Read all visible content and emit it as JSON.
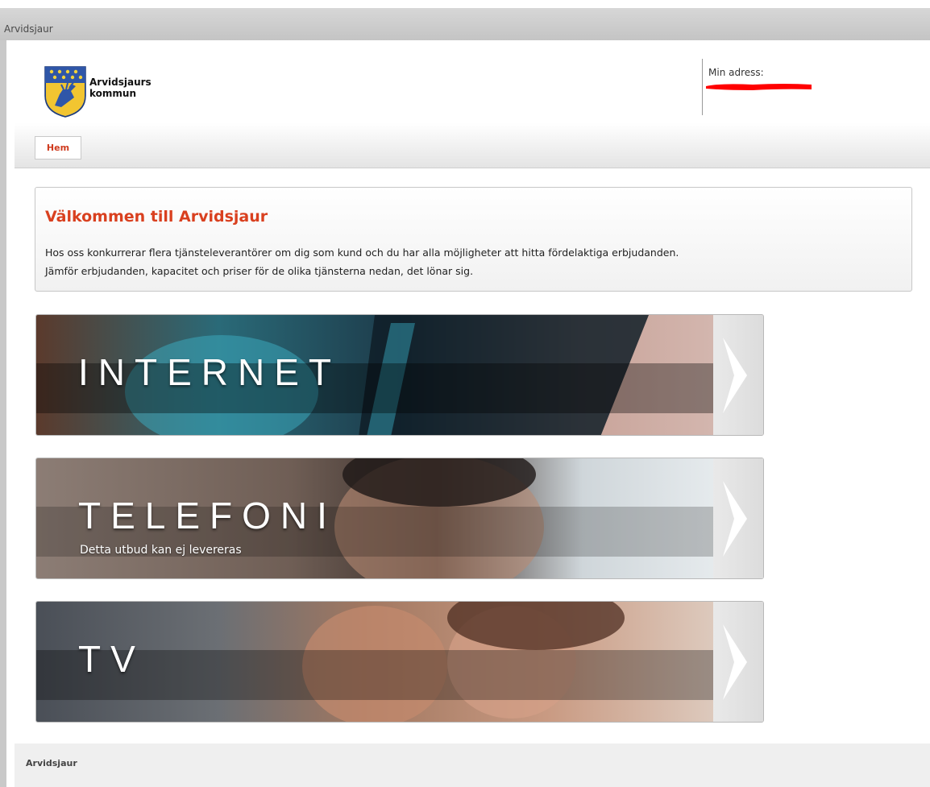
{
  "window": {
    "title": "Arvidsjaur"
  },
  "header": {
    "logo_line1": "Arvidsjaurs",
    "logo_line2": "kommun",
    "address_label": "Min adress:"
  },
  "nav": {
    "items": [
      {
        "label": "Hem",
        "active": true
      }
    ]
  },
  "welcome": {
    "title": "Välkommen till Arvidsjaur",
    "line1": "Hos oss konkurrerar flera tjänsteleverantörer om dig som kund och du har alla möjligheter att hitta fördelaktiga erbjudanden.",
    "line2": "Jämför erbjudanden, kapacitet och priser för de olika tjänsterna nedan, det lönar sig."
  },
  "services": [
    {
      "label": "INTERNET",
      "note": ""
    },
    {
      "label": "TELEFONI",
      "note": "Detta utbud kan ej levereras"
    },
    {
      "label": "TV",
      "note": ""
    }
  ],
  "footer": {
    "text": "Arvidsjaur"
  },
  "colors": {
    "accent": "#d9401f",
    "redaction": "#ff0000"
  }
}
